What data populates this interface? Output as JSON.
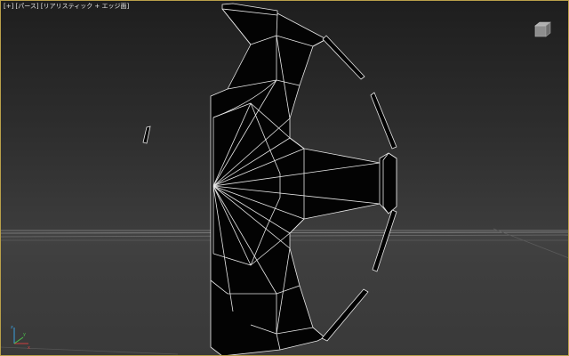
{
  "viewport": {
    "label": "[+] [パース] [リアリスティック + エッジ面]",
    "colors": {
      "active_border": "#b9a04a",
      "mesh_fill": "#030303",
      "mesh_edges": "#e8e8e8",
      "grid": "#8a8a8a"
    },
    "icons": [
      "viewcube-icon",
      "axis-tripod-icon"
    ],
    "axes": [
      "x",
      "y",
      "z"
    ]
  }
}
